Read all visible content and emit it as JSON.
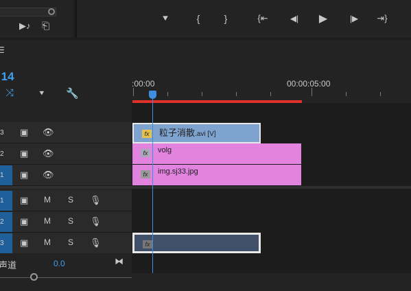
{
  "source_monitor": {
    "controls": [
      {
        "name": "export-frame-icon",
        "glyph": "⇲"
      },
      {
        "name": "insert-icon",
        "glyph": "⇩"
      }
    ]
  },
  "program_monitor": {
    "controls": [
      {
        "name": "add-marker-icon",
        "glyph": "⯆"
      },
      {
        "name": "mark-in-icon",
        "glyph": "{"
      },
      {
        "name": "mark-out-icon",
        "glyph": "}"
      },
      {
        "name": "go-to-in-icon",
        "glyph": "{⇤"
      },
      {
        "name": "step-back-icon",
        "glyph": "◀|"
      },
      {
        "name": "play-icon",
        "glyph": "▶"
      },
      {
        "name": "step-forward-icon",
        "glyph": "|▶"
      },
      {
        "name": "go-to-out-icon",
        "glyph": "⇥}"
      }
    ]
  },
  "timeline": {
    "menu_icon": "☰",
    "timecode": ":14",
    "tool_icons": [
      {
        "name": "snap-icon",
        "glyph": "⤨"
      },
      {
        "name": "add-marker-icon",
        "glyph": "⯆"
      },
      {
        "name": "wrench-icon",
        "glyph": "🔧"
      }
    ],
    "ruler": {
      "start_label": ":00:00",
      "mid_label": "00:00:05:00"
    },
    "video_tracks": [
      {
        "tag": "3",
        "clip": {
          "name": "粒子消散",
          "suffix": ".avi [V]",
          "color": "#7fa3cf",
          "fx_color": "#e6c24a"
        }
      },
      {
        "tag": "2",
        "clip": {
          "name": "volg",
          "suffix": "",
          "color": "#e283e0",
          "fx_color": "#a9a9b9"
        }
      },
      {
        "tag": "1",
        "clip": {
          "name": "img.sj33.jpg",
          "suffix": "",
          "color": "#e283e0",
          "fx_color": "#9a9a9a"
        }
      }
    ],
    "audio_tracks": [
      {
        "tag": "1",
        "m": "M",
        "s": "S"
      },
      {
        "tag": "2",
        "m": "M",
        "s": "S"
      },
      {
        "tag": "3",
        "m": "M",
        "s": "S"
      }
    ],
    "audio_clip": {
      "color": "#3f5068",
      "fx_color": "#777777"
    },
    "master": {
      "label": "声道",
      "value": "0.0"
    }
  }
}
